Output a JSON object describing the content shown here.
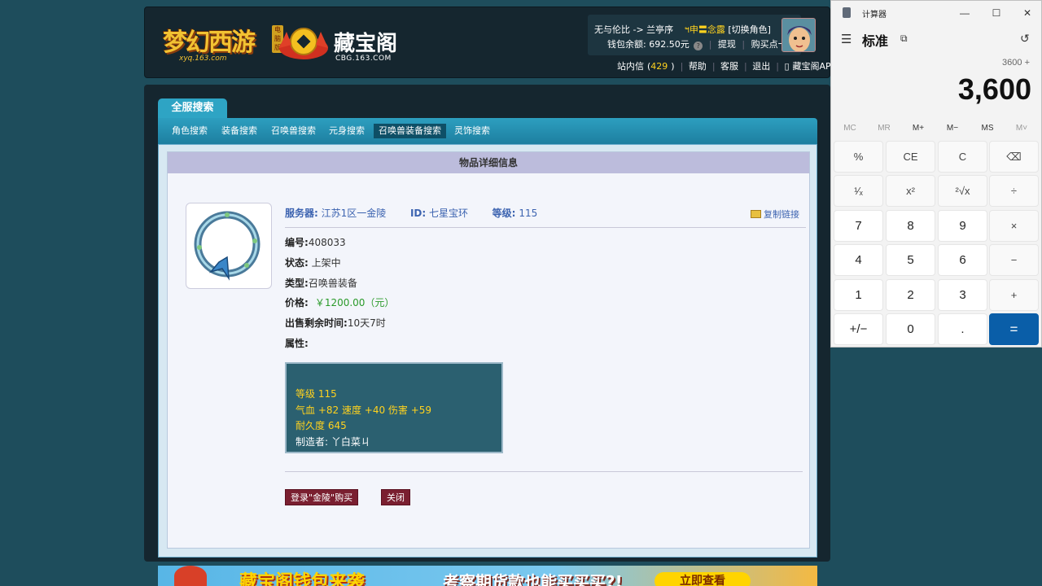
{
  "header": {
    "logo_game": "梦幻西游",
    "logo_game_sub": "xyq.163.com",
    "logo_game_tag": "电脑版",
    "logo_site": "藏宝阁",
    "logo_site_domain": "CBG.163.COM",
    "server_path": "无与伦比 -> 兰亭序",
    "role_name": "ฯ申〓念露",
    "switch_role": "[切换角色]",
    "wallet_label": "钱包余额: ",
    "wallet_amount": "692.50元",
    "withdraw": "提现",
    "buy_card": "购买点卡",
    "inbox_label": "站内信",
    "inbox_count": "429",
    "help": "帮助",
    "service": "客服",
    "logout": "退出",
    "app": "藏宝阁APP"
  },
  "tabs": {
    "main": "全服搜索",
    "sub": [
      "角色搜索",
      "装备搜索",
      "召唤兽搜索",
      "元身搜索",
      "召唤兽装备搜索",
      "灵饰搜索"
    ]
  },
  "item": {
    "panel_title": "物品详细信息",
    "server_label": "服务器:",
    "server_value": "江苏1区一金陵",
    "id_label": "ID:",
    "id_value": "七星宝环",
    "level_label": "等级:",
    "level_value": "115",
    "copy_link": "复制链接",
    "serial_label": "编号:",
    "serial_value": "408033",
    "status_label": "状态:",
    "status_value": "上架中",
    "type_label": "类型:",
    "type_value": "召唤兽装备",
    "price_label": "价格:",
    "price_value": "￥1200.00（元）",
    "time_label": "出售剩余时间:",
    "time_value": "10天7时",
    "attr_label": "属性:",
    "attrs": [
      "等级 115",
      "气血 +82 速度 +40 伤害 +59",
      "耐久度 645"
    ],
    "maker": "制造者: 丫白菜ㄐ",
    "buy_button": "登录\"金陵\"购买",
    "close_button": "关闭"
  },
  "banner": {
    "text1": "藏宝阁钱包来袭",
    "text2": "考察期货款也能买买买?!",
    "cta": "立即查看"
  },
  "calculator": {
    "window_title": "计算器",
    "mode": "标准",
    "expression": "3600 +",
    "display": "3,600",
    "memory": [
      "MC",
      "MR",
      "M+",
      "M−",
      "MS",
      "M˅"
    ],
    "keys": [
      "%",
      "CE",
      "C",
      "⌫",
      "¹⁄ₓ",
      "x²",
      "²√x",
      "÷",
      "7",
      "8",
      "9",
      "×",
      "4",
      "5",
      "6",
      "−",
      "1",
      "2",
      "3",
      "+",
      "+/−",
      "0",
      ".",
      "="
    ]
  }
}
